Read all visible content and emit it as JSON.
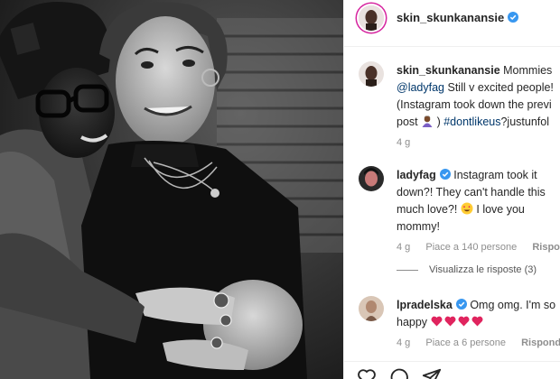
{
  "post": {
    "author": "skin_skunkanansie",
    "verified": true
  },
  "caption": {
    "author": "skin_skunkanansie",
    "line1_text": "Mommies",
    "line2_mention": "@ladyfag",
    "line2_text": "Still v excited people!",
    "line3": "(Instagram took down the previ",
    "line4_text": "post",
    "line4_hashtag": "#dontlikeus",
    "line4_rest": "?justunfol",
    "time": "4 g"
  },
  "comments": [
    {
      "author": "ladyfag",
      "verified": true,
      "lines": [
        "Instagram took it",
        "down?! They can't handle this",
        "much love?!",
        "I love you",
        "mommy!"
      ],
      "time": "4 g",
      "likes": "Piace a 140 persone",
      "reply": "Rispondi"
    },
    {
      "author": "lpradelska",
      "verified": true,
      "lines": [
        "Omg omg. I'm so",
        "happy"
      ],
      "time": "4 g",
      "likes": "Piace a 6 persone",
      "reply": "Rispondi"
    }
  ],
  "view_replies": "Visualizza le risposte (3)",
  "icons": {
    "verified": "verified-badge-icon",
    "heart": "heart-icon",
    "comment": "comment-icon",
    "share": "share-icon"
  },
  "colors": {
    "verified": "#3897f0",
    "link": "#00376b",
    "meta": "#8e8e8e",
    "heart_red": "#e0245e"
  }
}
